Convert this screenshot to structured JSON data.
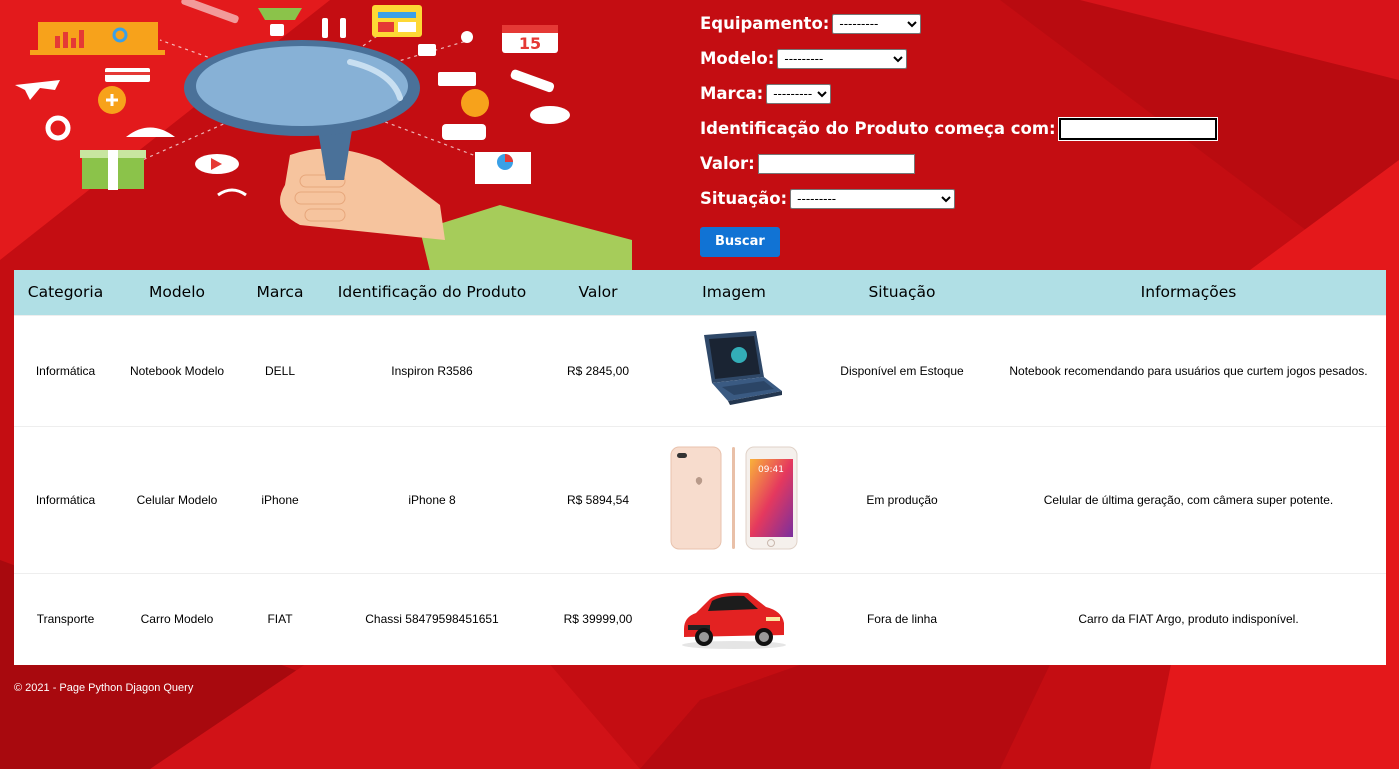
{
  "form": {
    "equipamento": {
      "label": "Equipamento:",
      "value": "---------"
    },
    "modelo": {
      "label": "Modelo:",
      "value": "---------"
    },
    "marca": {
      "label": "Marca:",
      "value": "---------"
    },
    "identificacao": {
      "label": "Identificação do Produto começa com:",
      "value": ""
    },
    "valor": {
      "label": "Valor:",
      "value": ""
    },
    "situacao": {
      "label": "Situação:",
      "value": "---------"
    },
    "buscar_label": "Buscar"
  },
  "table": {
    "headers": [
      "Categoria",
      "Modelo",
      "Marca",
      "Identificação do Produto",
      "Valor",
      "Imagem",
      "Situação",
      "Informações"
    ],
    "rows": [
      {
        "categoria": "Informática",
        "modelo": "Notebook Modelo",
        "marca": "DELL",
        "identificacao": "Inspiron R3586",
        "valor": "R$ 2845,00",
        "imagem": "laptop-image",
        "situacao": "Disponível em Estoque",
        "informacoes": "Notebook recomendando para usuários que curtem jogos pesados."
      },
      {
        "categoria": "Informática",
        "modelo": "Celular Modelo",
        "marca": "iPhone",
        "identificacao": "iPhone 8",
        "valor": "R$ 5894,54",
        "imagem": "phone-image",
        "situacao": "Em produção",
        "informacoes": "Celular de última geração, com câmera super potente."
      },
      {
        "categoria": "Transporte",
        "modelo": "Carro Modelo",
        "marca": "FIAT",
        "identificacao": "Chassi 58479598451651",
        "valor": "R$ 39999,00",
        "imagem": "car-image",
        "situacao": "Fora de linha",
        "informacoes": "Carro da FIAT Argo, produto indisponível."
      }
    ]
  },
  "phone_time": "09:41",
  "calendar_day": "15",
  "footer": "© 2021 - Page Python Djagon Query",
  "colors": {
    "background": "#c30d12",
    "header_row": "#b0dfe5",
    "button": "#1173d4"
  }
}
